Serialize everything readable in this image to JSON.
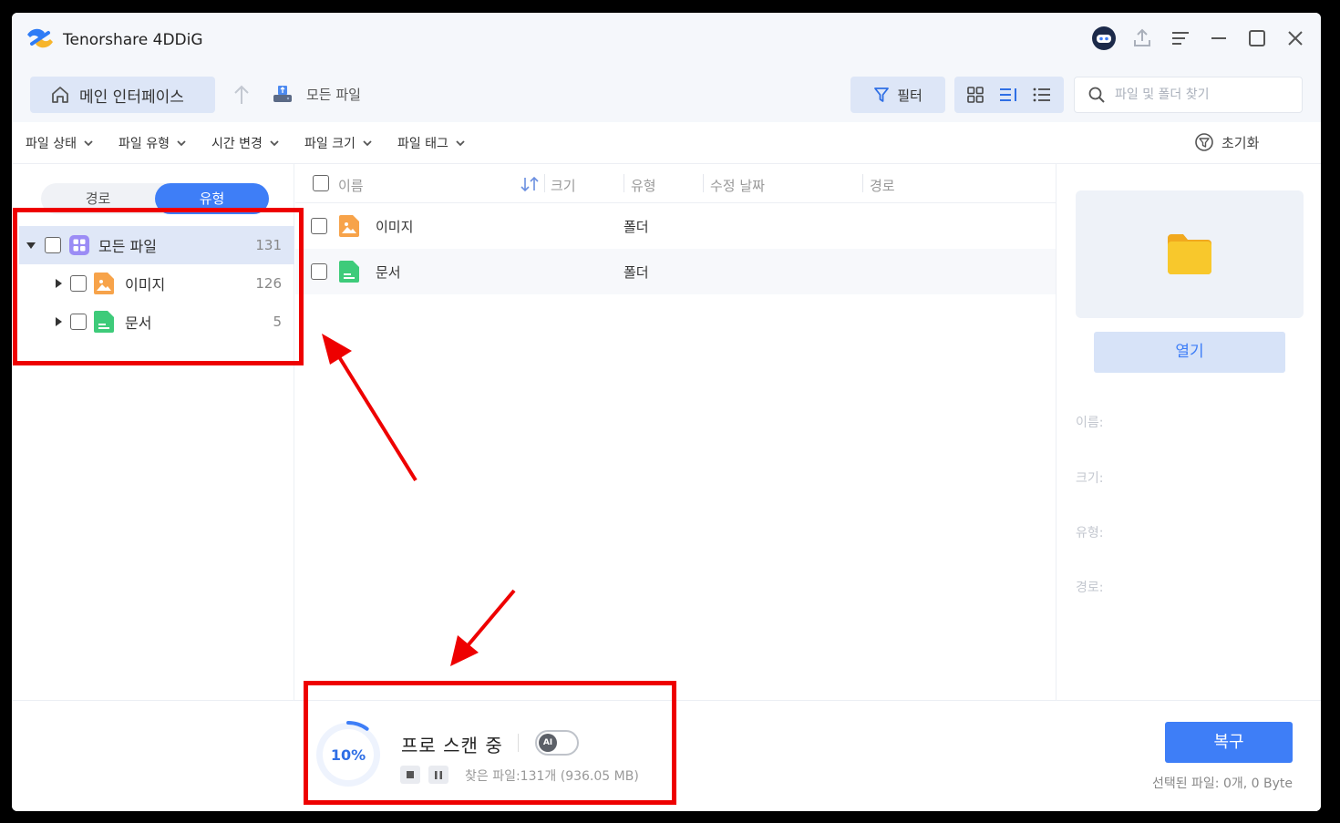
{
  "app": {
    "title": "Tenorshare 4DDiG"
  },
  "toolbar": {
    "home_label": "메인 인터페이스",
    "breadcrumb_label": "모든 파일",
    "filter_label": "필터",
    "search_placeholder": "파일 및 폴더 찾기"
  },
  "filters": {
    "items": [
      "파일 상태",
      "파일 유형",
      "시간 변경",
      "파일 크기",
      "파일 태그"
    ],
    "reset_label": "초기화"
  },
  "sidebar": {
    "tab_path": "경로",
    "tab_type": "유형",
    "active_tab": "유형",
    "tree": [
      {
        "label": "모든 파일",
        "count": "131"
      },
      {
        "label": "이미지",
        "count": "126"
      },
      {
        "label": "문서",
        "count": "5"
      }
    ]
  },
  "table": {
    "columns": [
      "이름",
      "크기",
      "유형",
      "수정 날짜",
      "경로"
    ],
    "rows": [
      {
        "name": "이미지",
        "type": "폴더"
      },
      {
        "name": "문서",
        "type": "폴더"
      }
    ]
  },
  "details": {
    "open_label": "열기",
    "name_label": "이름:",
    "size_label": "크기:",
    "type_label": "유형:",
    "path_label": "경로:"
  },
  "scan": {
    "percent": "10%",
    "progress_fraction": 0.1,
    "title": "프로 스캔 중",
    "ai_badge": "AI",
    "found_text": "찾은 파일:131개 (936.05 MB)"
  },
  "footer": {
    "recover_label": "복구",
    "selected_text": "선택된 파일: 0개, 0 Byte"
  },
  "colors": {
    "accent": "#3e7ef7",
    "annotation": "#e00000",
    "image_icon": "#f7a34a",
    "document_icon": "#3ecb7a",
    "folder_icon": "#f8c02c"
  }
}
